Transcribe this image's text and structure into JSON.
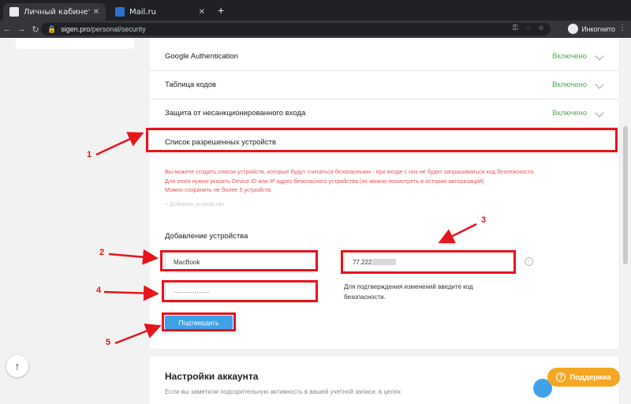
{
  "browser": {
    "tabs": [
      {
        "title": "Личный кабинет | SIGEN.pro",
        "active": true
      },
      {
        "title": "Mail.ru",
        "active": false
      }
    ],
    "url_host": "sigen.pro",
    "url_path": "/personal/security",
    "incognito_label": "Инкогнито"
  },
  "security": {
    "rows": [
      {
        "label": "Google Authentication",
        "status": "Включено"
      },
      {
        "label": "Таблица кодов",
        "status": "Включено"
      },
      {
        "label": "Защита от несанкционированного входа",
        "status": "Включено"
      }
    ],
    "devices_title": "Список разрешенных устройств",
    "info_lines": [
      "Вы можете создать список устройств, которые будут считаться безопасными - при входе с них не будет запрашиваться код безопасности.",
      "Для этого нужно указать Device ID или IP адрес безопасного устройства (их можно посмотреть в истории авторизаций)",
      "Можно сохранить не более 5 устройств."
    ],
    "add_device_link": "+ Добавить устройство",
    "add_title": "Добавление устройства",
    "device_name_value": "MacBook",
    "ip_value": "77.222",
    "code_value": "·················",
    "hint": "Для подтверждения изменений введите код безопасности.",
    "confirm_label": "Подтвердить"
  },
  "account": {
    "title": "Настройки аккаунта",
    "text": "Если вы заметили подозрительную активность в вашей учетной записи, в целях"
  },
  "support_label": "Поддержка",
  "annotations": {
    "n1": "1",
    "n2": "2",
    "n3": "3",
    "n4": "4",
    "n5": "5"
  },
  "colors": {
    "accent": "#3fa2e9",
    "enabled": "#4caf50",
    "warning_text": "#e15759",
    "highlight": "#e8141c",
    "support": "#f5a623"
  }
}
